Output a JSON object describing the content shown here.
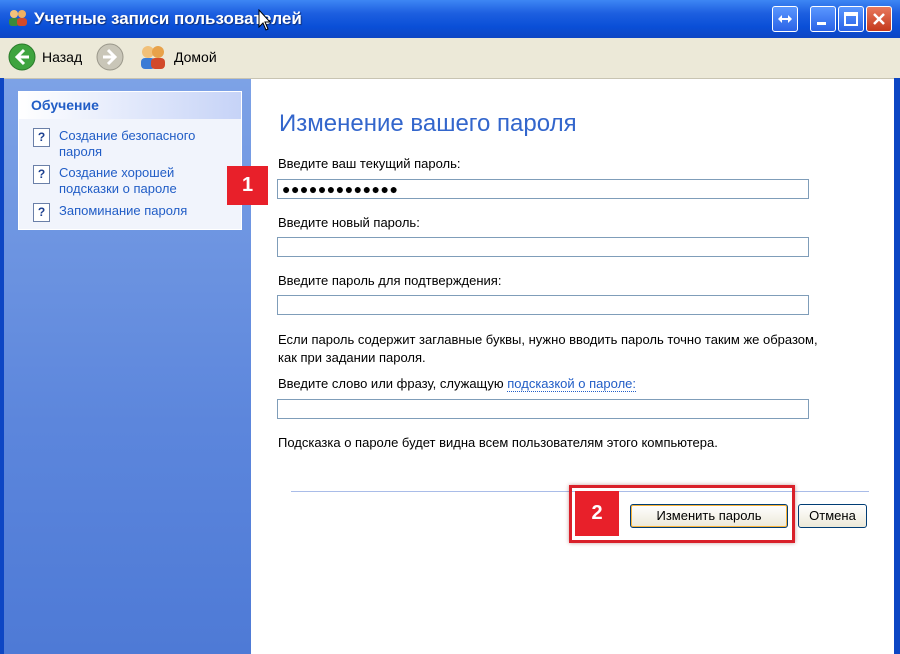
{
  "window": {
    "title": "Учетные записи пользователей",
    "icon": "users-icon",
    "colors": {
      "titlebar": "#0a4fd7",
      "side_pane": "#6d93e0",
      "link": "#215dc6",
      "annotation": "#e8202a"
    }
  },
  "nav": {
    "back_label": "Назад",
    "home_label": "Домой"
  },
  "sidebar": {
    "header": "Обучение",
    "items": [
      {
        "label": "Создание безопасного пароля",
        "icon": "help-icon"
      },
      {
        "label": "Создание хорошей подсказки о пароле",
        "icon": "help-icon"
      },
      {
        "label": "Запоминание пароля",
        "icon": "help-icon"
      }
    ]
  },
  "main": {
    "title": "Изменение вашего пароля",
    "current_password_label": "Введите ваш текущий пароль:",
    "current_password_value": "●●●●●●●●●●●●●",
    "new_password_label": "Введите новый пароль:",
    "confirm_password_label": "Введите пароль для подтверждения:",
    "case_note": "Если пароль содержит заглавные буквы, нужно вводить пароль точно таким же образом, как при задании пароля.",
    "hint_label_prefix": "Введите слово или фразу, служащую ",
    "hint_label_link": "подсказкой о пароле:",
    "hint_visibility_note": "Подсказка о пароле будет видна всем пользователям этого компьютера.",
    "change_button": "Изменить пароль",
    "cancel_button": "Отмена"
  },
  "annotations": {
    "badge_1": "1",
    "badge_2": "2"
  }
}
